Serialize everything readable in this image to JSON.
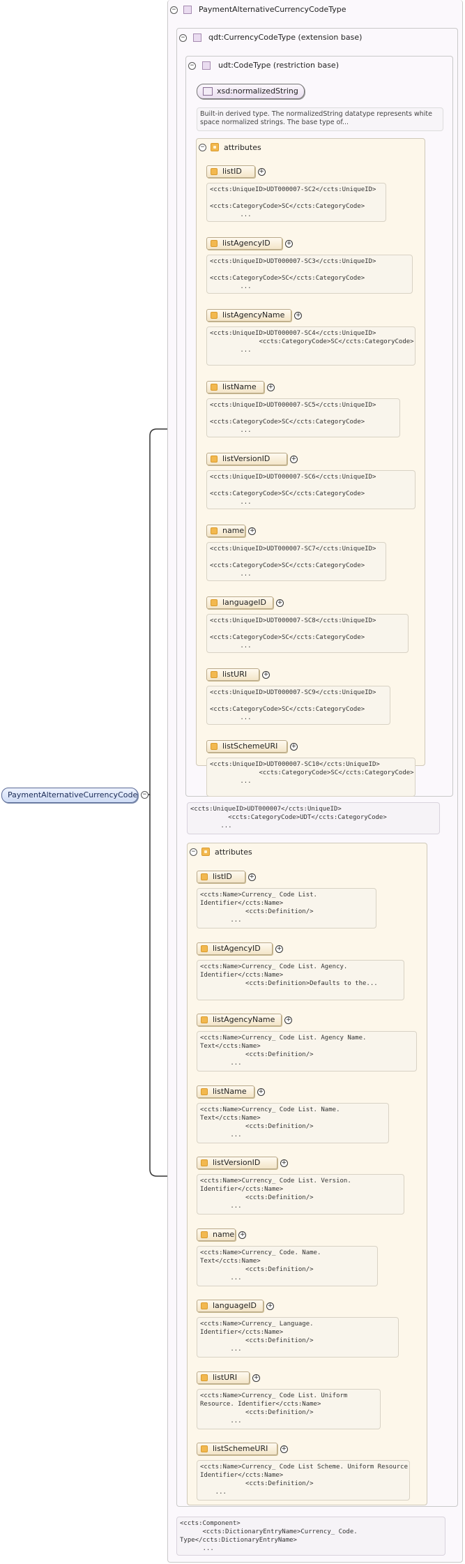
{
  "root": {
    "label": "PaymentAlternativeCurrencyCode"
  },
  "outer": {
    "label": "PaymentAlternativeCurrencyCodeType"
  },
  "ext": {
    "label": "qdt:CurrencyCodeType (extension base)"
  },
  "restr": {
    "label": "udt:CodeType (restriction base)"
  },
  "xsd": {
    "label": "xsd:normalizedString",
    "doc": "Built-in derived type. The normalizedString datatype represents white space normalized strings. The base type of..."
  },
  "udt_attributes": {
    "title": "attributes",
    "items": [
      {
        "name": "listID",
        "note": "<ccts:UniqueID>UDT000007-SC2</ccts:UniqueID>\n\n<ccts:CategoryCode>SC</ccts:CategoryCode>\n        ..."
      },
      {
        "name": "listAgencyID",
        "note": "<ccts:UniqueID>UDT000007-SC3</ccts:UniqueID>\n\n<ccts:CategoryCode>SC</ccts:CategoryCode>\n        ..."
      },
      {
        "name": "listAgencyName",
        "note": "<ccts:UniqueID>UDT000007-SC4</ccts:UniqueID>\n             <ccts:CategoryCode>SC</ccts:CategoryCode>\n        ..."
      },
      {
        "name": "listName",
        "note": "<ccts:UniqueID>UDT000007-SC5</ccts:UniqueID>\n\n<ccts:CategoryCode>SC</ccts:CategoryCode>\n        ..."
      },
      {
        "name": "listVersionID",
        "note": "<ccts:UniqueID>UDT000007-SC6</ccts:UniqueID>\n\n<ccts:CategoryCode>SC</ccts:CategoryCode>\n        ..."
      },
      {
        "name": "name",
        "note": "<ccts:UniqueID>UDT000007-SC7</ccts:UniqueID>\n\n<ccts:CategoryCode>SC</ccts:CategoryCode>\n        ..."
      },
      {
        "name": "languageID",
        "note": "<ccts:UniqueID>UDT000007-SC8</ccts:UniqueID>\n\n<ccts:CategoryCode>SC</ccts:CategoryCode>\n        ..."
      },
      {
        "name": "listURI",
        "note": "<ccts:UniqueID>UDT000007-SC9</ccts:UniqueID>\n\n<ccts:CategoryCode>SC</ccts:CategoryCode>\n        ..."
      },
      {
        "name": "listSchemeURI",
        "note": "<ccts:UniqueID>UDT000007-SC10</ccts:UniqueID>\n             <ccts:CategoryCode>SC</ccts:CategoryCode>\n        ..."
      }
    ]
  },
  "qdt_note": "<ccts:UniqueID>UDT000007</ccts:UniqueID>\n          <ccts:CategoryCode>UDT</ccts:CategoryCode>\n        ...",
  "qdt_attributes": {
    "title": "attributes",
    "items": [
      {
        "name": "listID",
        "note": "<ccts:Name>Currency_ Code List.\nIdentifier</ccts:Name>\n            <ccts:Definition/>\n        ..."
      },
      {
        "name": "listAgencyID",
        "note": "<ccts:Name>Currency_ Code List. Agency.\nIdentifier</ccts:Name>\n            <ccts:Definition>Defaults to the...\n"
      },
      {
        "name": "listAgencyName",
        "note": "<ccts:Name>Currency_ Code List. Agency Name.\nText</ccts:Name>\n            <ccts:Definition/>\n        ..."
      },
      {
        "name": "listName",
        "note": "<ccts:Name>Currency_ Code List. Name.\nText</ccts:Name>\n            <ccts:Definition/>\n        ..."
      },
      {
        "name": "listVersionID",
        "note": "<ccts:Name>Currency_ Code List. Version.\nIdentifier</ccts:Name>\n            <ccts:Definition/>\n        ..."
      },
      {
        "name": "name",
        "note": "<ccts:Name>Currency_ Code. Name.\nText</ccts:Name>\n            <ccts:Definition/>\n        ..."
      },
      {
        "name": "languageID",
        "note": "<ccts:Name>Currency_ Language.\nIdentifier</ccts:Name>\n            <ccts:Definition/>\n        ..."
      },
      {
        "name": "listURI",
        "note": "<ccts:Name>Currency_ Code List. Uniform\nResource. Identifier</ccts:Name>\n            <ccts:Definition/>\n        ..."
      },
      {
        "name": "listSchemeURI",
        "note": "<ccts:Name>Currency_ Code List Scheme. Uniform Resource.\nIdentifier</ccts:Name>\n            <ccts:Definition/>\n    ..."
      }
    ]
  },
  "component_note": "<ccts:Component>\n      <ccts:DictionaryEntryName>Currency_ Code.\nType</ccts:DictionaryEntryName>\n      ...",
  "toggles": {
    "minus": "−",
    "plus": "+"
  }
}
